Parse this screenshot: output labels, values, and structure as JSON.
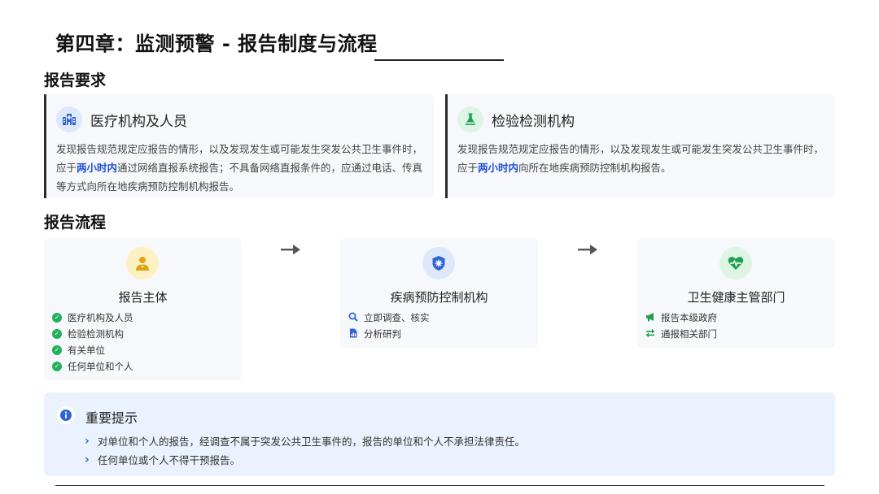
{
  "page": {
    "title": "第四章：监测预警 - 报告制度与流程"
  },
  "requirements": {
    "heading": "报告要求",
    "cards": [
      {
        "icon": "hospital-building-icon",
        "title": "医疗机构及人员",
        "text_before": "发现报告规范规定应报告的情形，以及发现发生或可能发生突发公共卫生事件时，应于",
        "highlight": "两小时内",
        "text_after": "通过网络直报系统报告；不具备网络直报条件的，应通过电话、传真等方式向所在地疾病预防控制机构报告。"
      },
      {
        "icon": "flask-icon",
        "title": "检验检测机构",
        "text_before": "发现报告规范规定应报告的情形，以及发现发生或可能发生突发公共卫生事件时，应于",
        "highlight": "两小时内",
        "text_after": "向所在地疾病预防控制机构报告。"
      }
    ]
  },
  "flow": {
    "heading": "报告流程",
    "steps": [
      {
        "icon": "doctor-icon",
        "title": "报告主体",
        "items": [
          {
            "icon": "check-circle-icon",
            "label": "医疗机构及人员"
          },
          {
            "icon": "check-circle-icon",
            "label": "检验检测机构"
          },
          {
            "icon": "check-circle-icon",
            "label": "有关单位"
          },
          {
            "icon": "check-circle-icon",
            "label": "任何单位和个人"
          }
        ]
      },
      {
        "icon": "shield-virus-icon",
        "title": "疾病预防控制机构",
        "items": [
          {
            "icon": "search-icon",
            "label": "立即调查、核实"
          },
          {
            "icon": "document-chart-icon",
            "label": "分析研判"
          }
        ]
      },
      {
        "icon": "heart-pulse-icon",
        "title": "卫生健康主管部门",
        "items": [
          {
            "icon": "megaphone-icon",
            "label": "报告本级政府"
          },
          {
            "icon": "exchange-icon",
            "label": "通报相关部门"
          }
        ]
      }
    ]
  },
  "notice": {
    "title": "重要提示",
    "items": [
      "对单位和个人的报告，经调查不属于突发公共卫生事件的，报告的单位和个人不承担法律责任。",
      "任何单位或个人不得干预报告。"
    ]
  },
  "colors": {
    "accent_blue": "#1f4fd8",
    "success_green": "#23b05a",
    "card_bg": "#f6f8fb",
    "notice_bg": "#eaf2fd"
  }
}
